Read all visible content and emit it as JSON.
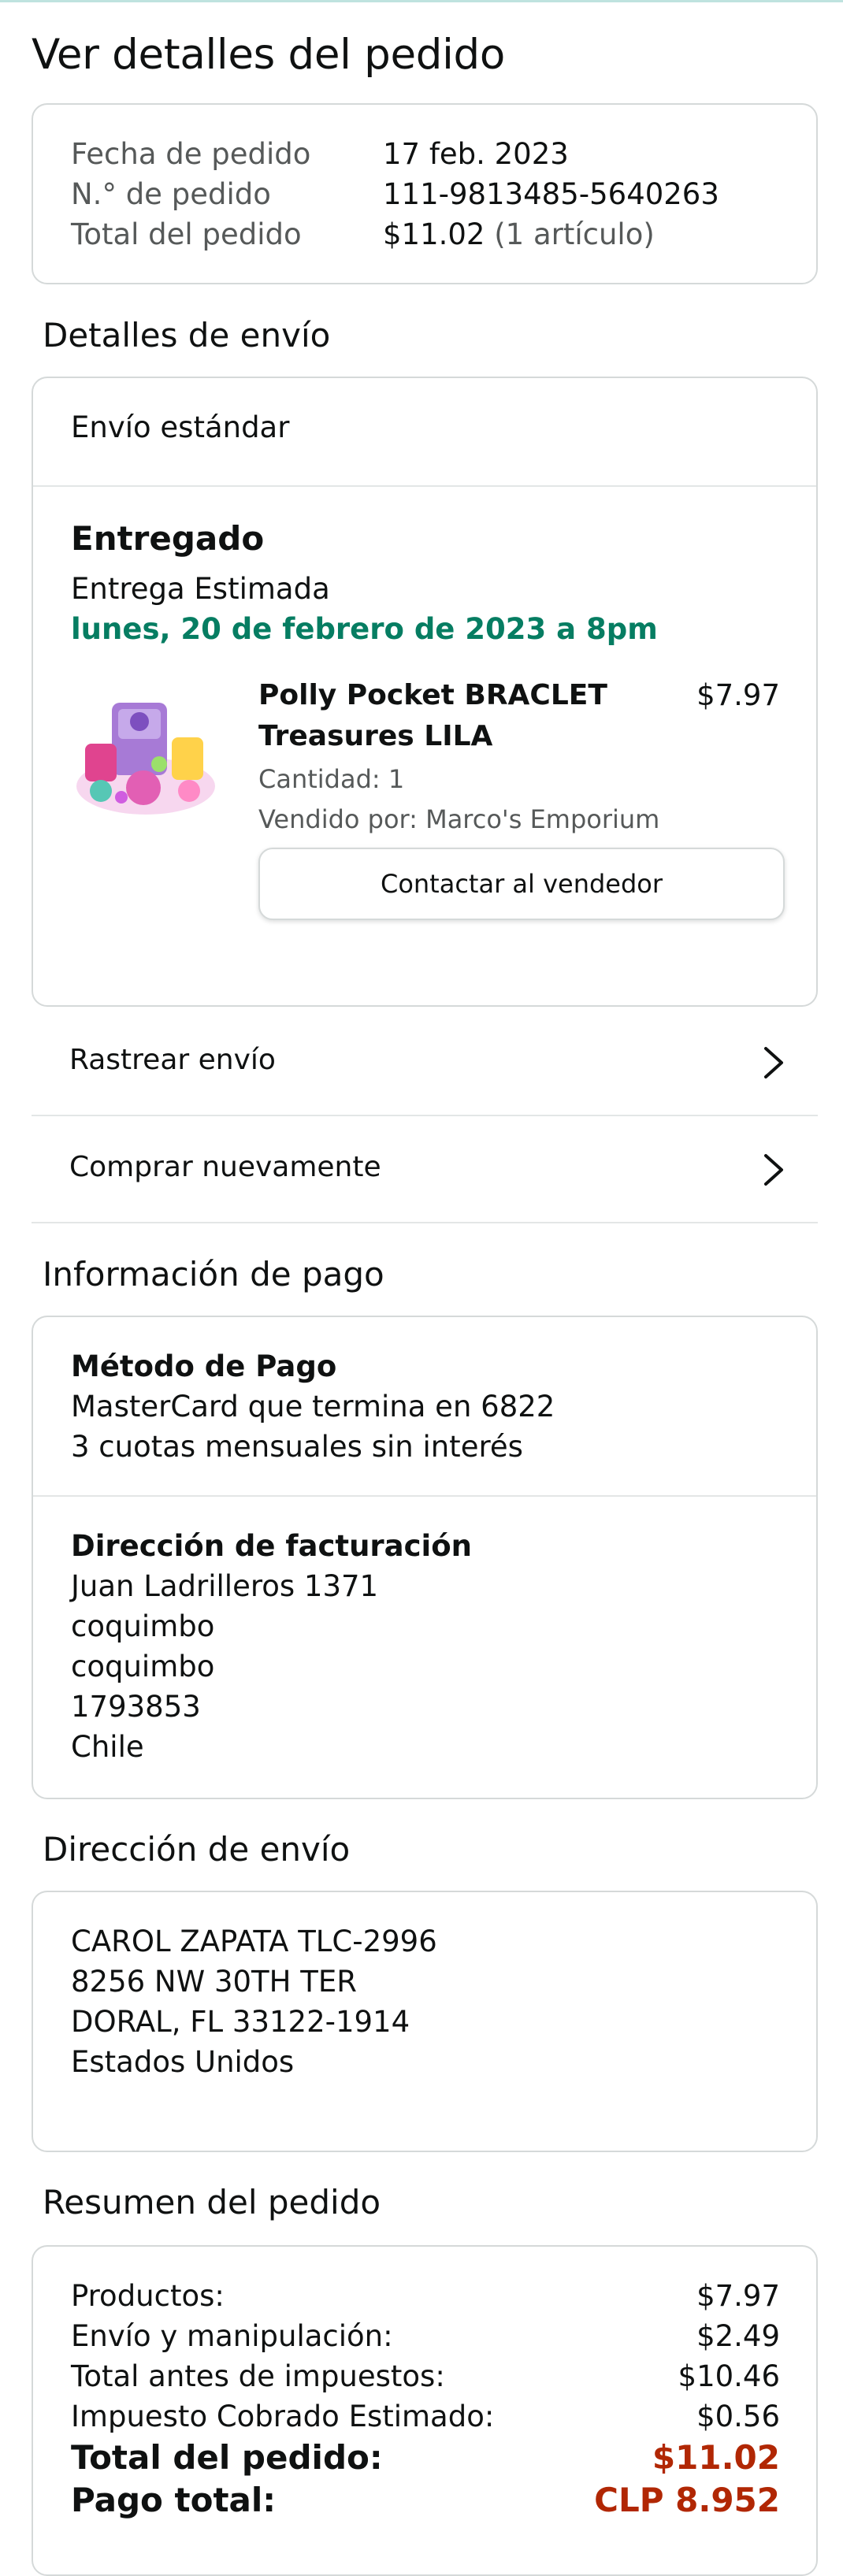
{
  "header": {
    "title": "Ver detalles del pedido"
  },
  "summary": {
    "rows": [
      {
        "label": "Fecha de pedido",
        "value": "17 feb. 2023",
        "extra": ""
      },
      {
        "label": "N.° de pedido",
        "value": "111-9813485-5640263",
        "extra": ""
      },
      {
        "label": "Total del pedido",
        "value": "$11.02",
        "extra": "(1 artículo)"
      }
    ]
  },
  "shipping_details": {
    "title": "Detalles de envío",
    "method": "Envío estándar",
    "status": "Entregado",
    "estimate_label": "Entrega Estimada",
    "estimate_date": "lunes, 20 de febrero de 2023 a 8pm",
    "item": {
      "name_line1": "Polly Pocket BRACLET",
      "name_line2": "Treasures LILA",
      "price": "$7.97",
      "quantity": "Cantidad: 1",
      "seller": "Vendido por: Marco's Emporium",
      "contact_button": "Contactar al vendedor",
      "image_icon": "product-toy-icon"
    },
    "links": [
      {
        "label": "Rastrear envío",
        "icon": "chevron-right-icon"
      },
      {
        "label": "Comprar nuevamente",
        "icon": "chevron-right-icon"
      }
    ]
  },
  "payment": {
    "title": "Información de pago",
    "method_title": "Método de Pago",
    "method_line1": "MasterCard que termina en 6822",
    "method_line2": "3 cuotas mensuales sin interés",
    "billing_title": "Dirección de facturación",
    "billing_lines": [
      "Juan Ladrilleros 1371",
      "coquimbo",
      "coquimbo",
      "1793853",
      "Chile"
    ]
  },
  "shipping_address": {
    "title": "Dirección de envío",
    "lines": [
      "CAROL ZAPATA TLC-2996",
      "8256 NW 30TH TER",
      "DORAL, FL 33122-1914",
      "Estados Unidos"
    ]
  },
  "order_summary": {
    "title": "Resumen del pedido",
    "rows": [
      {
        "label": "Productos:",
        "value": "$7.97"
      },
      {
        "label": "Envío y manipulación:",
        "value": "$2.49"
      },
      {
        "label": "Total antes de impuestos:",
        "value": "$10.46"
      },
      {
        "label": "Impuesto Cobrado Estimado:",
        "value": "$0.56"
      }
    ],
    "total_label": "Total del pedido:",
    "total_value": "$11.02",
    "paid_label": "Pago total:",
    "paid_value": "CLP 8.952"
  },
  "colors": {
    "accent_green": "#067d62",
    "price_red": "#b12704",
    "border": "#d5d9d9"
  }
}
